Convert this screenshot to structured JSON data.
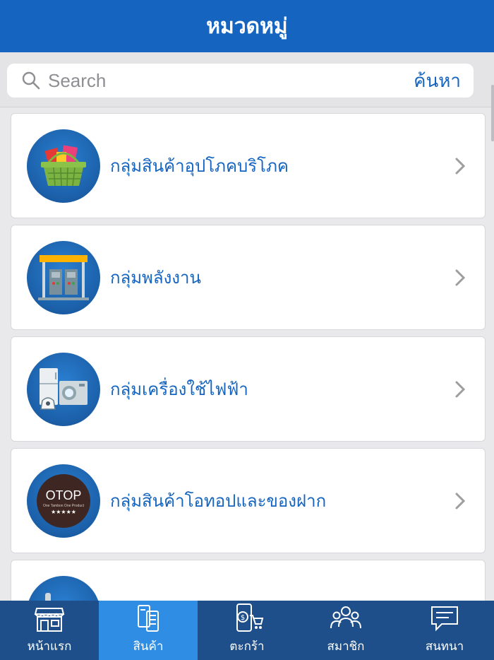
{
  "header": {
    "title": "หมวดหมู่"
  },
  "search": {
    "placeholder": "Search",
    "button_label": "ค้นหา"
  },
  "categories": [
    {
      "label": "กลุ่มสินค้าอุปโภคบริโภค",
      "icon": "basket-icon"
    },
    {
      "label": "กลุ่มพลังงาน",
      "icon": "fuel-pump-icon"
    },
    {
      "label": "กลุ่มเครื่องใช้ไฟฟ้า",
      "icon": "appliances-icon"
    },
    {
      "label": "กลุ่มสินค้าโอทอปและของฝาก",
      "icon": "otop-icon"
    },
    {
      "label": "",
      "icon": "faucet-icon"
    }
  ],
  "otop_logo": {
    "brand": "OTOP",
    "tagline": "One Tambon One Product",
    "stars": "★★★★★"
  },
  "tabs": [
    {
      "label": "หน้าแรก",
      "icon": "store-icon",
      "active": false
    },
    {
      "label": "สินค้า",
      "icon": "products-icon",
      "active": true
    },
    {
      "label": "ตะกร้า",
      "icon": "cart-icon",
      "active": false
    },
    {
      "label": "สมาชิก",
      "icon": "members-icon",
      "active": false
    },
    {
      "label": "สนทนา",
      "icon": "chat-icon",
      "active": false
    }
  ],
  "colors": {
    "primary": "#1565c0",
    "tabbar": "#1e4f8a",
    "tab_active": "#2f8de4"
  }
}
